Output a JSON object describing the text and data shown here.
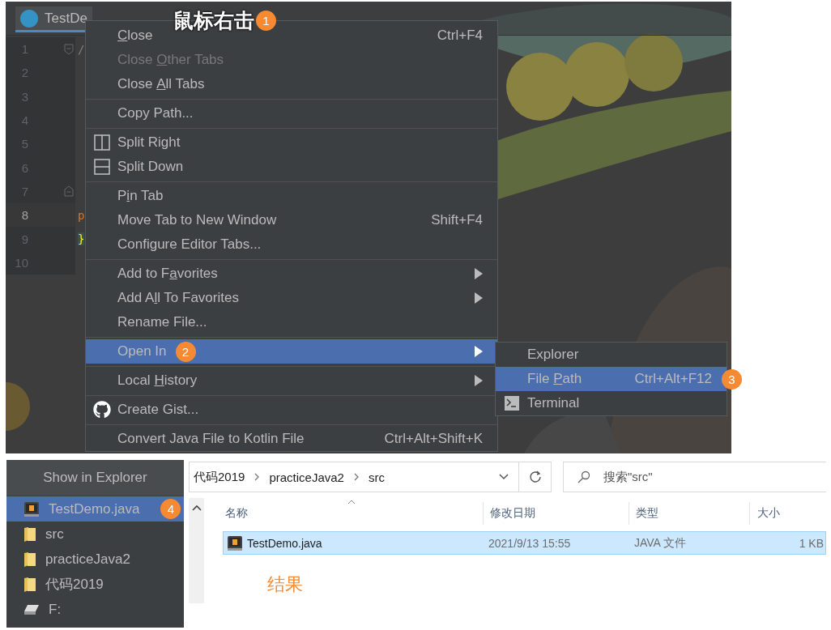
{
  "editor": {
    "tab": {
      "title": "TestDe"
    },
    "lines": [
      {
        "number": "1",
        "code": "/",
        "current": false
      },
      {
        "number": "2",
        "current": false
      },
      {
        "number": "3",
        "current": false
      },
      {
        "number": "4",
        "current": false
      },
      {
        "number": "5",
        "current": false
      },
      {
        "number": "6",
        "current": false
      },
      {
        "number": "7",
        "current": false
      },
      {
        "number": "8",
        "code": "p",
        "current": true
      },
      {
        "number": "9",
        "code": "}",
        "current": false
      },
      {
        "number": "10",
        "current": false
      }
    ]
  },
  "caption": {
    "text": "鼠标右击",
    "badge": "1"
  },
  "context_menu": {
    "items": [
      {
        "kind": "item",
        "parts": [
          {
            "text": "C",
            "underline": true
          },
          {
            "text": "lose",
            "underline": false
          }
        ],
        "shortcut": "Ctrl+F4",
        "disabled": false,
        "selected": false,
        "submenu": false
      },
      {
        "kind": "item",
        "parts": [
          {
            "text": "Close ",
            "underline": false
          },
          {
            "text": "O",
            "underline": true
          },
          {
            "text": "ther Tabs",
            "underline": false
          }
        ],
        "disabled": true,
        "selected": false,
        "submenu": false
      },
      {
        "kind": "item",
        "parts": [
          {
            "text": "Close ",
            "underline": false
          },
          {
            "text": "A",
            "underline": true
          },
          {
            "text": "ll Tabs",
            "underline": false
          }
        ],
        "disabled": false,
        "selected": false,
        "submenu": false
      },
      {
        "kind": "separator"
      },
      {
        "kind": "item",
        "parts": [
          {
            "text": "Copy Path...",
            "underline": false
          }
        ],
        "disabled": false,
        "selected": false,
        "submenu": false
      },
      {
        "kind": "separator"
      },
      {
        "kind": "item",
        "parts": [
          {
            "text": "Split Right",
            "underline": false
          }
        ],
        "disabled": false,
        "selected": false,
        "submenu": false
      },
      {
        "kind": "item",
        "parts": [
          {
            "text": "Split Down",
            "underline": false
          }
        ],
        "disabled": false,
        "selected": false,
        "submenu": false
      },
      {
        "kind": "separator"
      },
      {
        "kind": "item",
        "parts": [
          {
            "text": "P",
            "underline": false
          },
          {
            "text": "i",
            "underline": true
          },
          {
            "text": "n Tab",
            "underline": false
          }
        ],
        "disabled": false,
        "selected": false,
        "submenu": false
      },
      {
        "kind": "item",
        "parts": [
          {
            "text": "Move Tab to New Window",
            "underline": false
          }
        ],
        "shortcut": "Shift+F4",
        "disabled": false,
        "selected": false,
        "submenu": false
      },
      {
        "kind": "item",
        "parts": [
          {
            "text": "Configure Editor Tabs...",
            "underline": false
          }
        ],
        "disabled": false,
        "selected": false,
        "submenu": false
      },
      {
        "kind": "separator"
      },
      {
        "kind": "item",
        "parts": [
          {
            "text": "Add to F",
            "underline": false
          },
          {
            "text": "a",
            "underline": true
          },
          {
            "text": "vorites",
            "underline": false
          }
        ],
        "disabled": false,
        "selected": false,
        "submenu": true
      },
      {
        "kind": "item",
        "parts": [
          {
            "text": "Add A",
            "underline": false
          },
          {
            "text": "l",
            "underline": true
          },
          {
            "text": "l To Favorites",
            "underline": false
          }
        ],
        "disabled": false,
        "selected": false,
        "submenu": true
      },
      {
        "kind": "item",
        "parts": [
          {
            "text": "Rename File...",
            "underline": false
          }
        ],
        "disabled": false,
        "selected": false,
        "submenu": false
      },
      {
        "kind": "separator"
      },
      {
        "kind": "item",
        "parts": [
          {
            "text": "Open In",
            "underline": false
          }
        ],
        "badge": "2",
        "disabled": false,
        "selected": true,
        "submenu": true
      },
      {
        "kind": "separator"
      },
      {
        "kind": "item",
        "parts": [
          {
            "text": "Local ",
            "underline": false
          },
          {
            "text": "H",
            "underline": true
          },
          {
            "text": "istory",
            "underline": false
          }
        ],
        "disabled": false,
        "selected": false,
        "submenu": true
      },
      {
        "kind": "separator"
      },
      {
        "kind": "item",
        "parts": [
          {
            "text": "Create Gist...",
            "underline": false
          }
        ],
        "disabled": false,
        "selected": false,
        "submenu": false
      },
      {
        "kind": "separator"
      },
      {
        "kind": "item",
        "parts": [
          {
            "text": "Convert Java File to Kotlin File",
            "underline": false
          }
        ],
        "shortcut": "Ctrl+Alt+Shift+K",
        "disabled": false,
        "selected": false,
        "submenu": false
      }
    ]
  },
  "submenu": {
    "items": [
      {
        "kind": "item",
        "parts": [
          {
            "text": "Explorer",
            "underline": false
          }
        ],
        "disabled": false,
        "selected": false,
        "submenu": false
      },
      {
        "kind": "item",
        "parts": [
          {
            "text": "File ",
            "underline": false
          },
          {
            "text": "P",
            "underline": true
          },
          {
            "text": "ath",
            "underline": false
          }
        ],
        "shortcut": "Ctrl+Alt+F12",
        "badge": "3",
        "disabled": false,
        "selected": true,
        "submenu": false
      },
      {
        "kind": "item",
        "parts": [
          {
            "text": "Terminal",
            "underline": false
          }
        ],
        "disabled": false,
        "selected": false,
        "submenu": false
      }
    ]
  },
  "show_in_explorer": {
    "title": "Show in Explorer",
    "items": [
      {
        "label": "TestDemo.java",
        "selected": true,
        "badge": "4"
      },
      {
        "label": "src",
        "selected": false
      },
      {
        "label": "practiceJava2",
        "selected": false
      },
      {
        "label": "代码2019",
        "selected": false
      },
      {
        "label": "F:",
        "selected": false
      }
    ]
  },
  "explorer": {
    "breadcrumb": [
      "代码2019",
      "practiceJava2",
      "src"
    ],
    "search": {
      "placeholder": "搜索\"src\""
    },
    "columns": [
      "名称",
      "修改日期",
      "类型",
      "大小"
    ],
    "rows": [
      {
        "cells": [
          "TestDemo.java",
          "2021/9/13 15:55",
          "JAVA 文件",
          "1 KB"
        ],
        "selected": true
      }
    ]
  },
  "result_label": "结果"
}
